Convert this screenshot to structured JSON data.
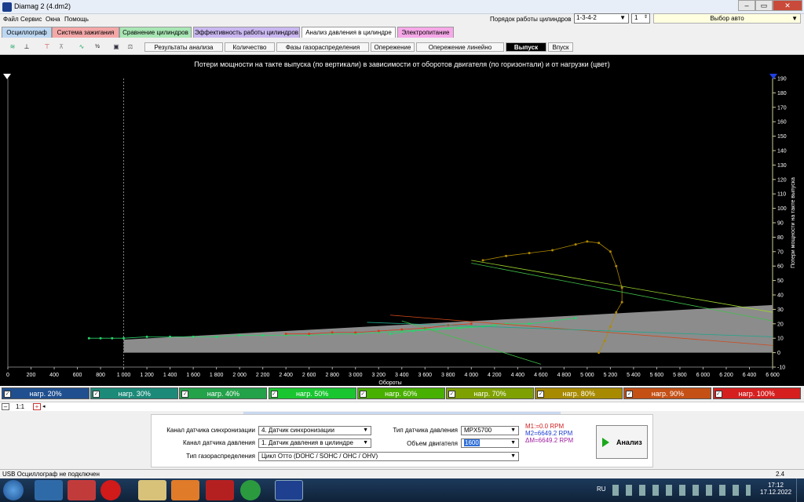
{
  "window": {
    "title": "Diamag 2 (4.dm2)"
  },
  "menu": [
    "Файл",
    "Сервис",
    "Окна",
    "Помощь"
  ],
  "cylinders": {
    "label": "Порядок работы цилиндров",
    "order": "1-3-4-2",
    "spin": "1",
    "auto": "Выбор авто"
  },
  "tabs": [
    {
      "label": "Осциллограф",
      "color": "#bcd7f2"
    },
    {
      "label": "Система зажигания",
      "color": "#f4a7a7"
    },
    {
      "label": "Сравнение цилиндров",
      "color": "#a8e6b4"
    },
    {
      "label": "Эффективность работы цилиндров",
      "color": "#c9b7f0"
    },
    {
      "label": "Анализ давления в цилиндре",
      "color": "#ffffff"
    },
    {
      "label": "Электропитание",
      "color": "#f6a8e8"
    }
  ],
  "subtabs": [
    "Результаты анализа",
    "Количество",
    "Фазы газораспределения",
    "Опережение",
    "Опережение линейно",
    "Выпуск",
    "Впуск"
  ],
  "chart_title": "Потери мощности на такте выпуска (по вертикали) в зависимости от оборотов двигателя (по горизонтали) и от нагрузки (цвет)",
  "chart_data": {
    "type": "scatter",
    "title": "Потери мощности на такте выпуска (по вертикали) в зависимости от оборотов двигателя (по горизонтали) и от нагрузки (цвет)",
    "xlabel": "Обороты",
    "ylabel": "Потери мощности на такте выпуска",
    "xlim": [
      0,
      6600
    ],
    "ylim": [
      -10,
      190
    ],
    "xticks": [
      0,
      200,
      400,
      600,
      800,
      1000,
      1200,
      1400,
      1600,
      1800,
      2000,
      2200,
      2400,
      2600,
      2800,
      3000,
      3200,
      3400,
      3600,
      3800,
      4000,
      4200,
      4400,
      4600,
      4800,
      5000,
      5200,
      5400,
      5600,
      5800,
      6000,
      6200,
      6400,
      6600
    ],
    "xtick_labels": [
      "0",
      "200",
      "400",
      "600",
      "800",
      "1 000",
      "1 200",
      "1 400",
      "1 600",
      "1 800",
      "2 000",
      "2 200",
      "2 400",
      "2 600",
      "2 800",
      "3 000",
      "3 200",
      "3 400",
      "3 600",
      "3 800",
      "4 000",
      "4 200",
      "4 400",
      "4 600",
      "4 800",
      "5 000",
      "5 200",
      "5 400",
      "5 600",
      "5 800",
      "6 000",
      "6 200",
      "6 400",
      "6 600"
    ],
    "yticks": [
      -10,
      0,
      10,
      20,
      30,
      40,
      50,
      60,
      70,
      80,
      90,
      100,
      110,
      120,
      130,
      140,
      150,
      160,
      170,
      180,
      190
    ],
    "series": [
      {
        "name": "нагр. 30%",
        "color": "#2bd26a",
        "points": [
          [
            700,
            10
          ],
          [
            800,
            10
          ],
          [
            900,
            10
          ],
          [
            1000,
            10
          ],
          [
            1200,
            11
          ],
          [
            1400,
            11
          ],
          [
            1600,
            11
          ],
          [
            1800,
            11
          ],
          [
            2000,
            12
          ],
          [
            2200,
            12
          ],
          [
            2400,
            12
          ],
          [
            2600,
            12
          ],
          [
            2800,
            13
          ],
          [
            3000,
            13
          ],
          [
            3200,
            14
          ],
          [
            3400,
            15
          ],
          [
            3600,
            16
          ],
          [
            3800,
            17
          ],
          [
            4000,
            18
          ],
          [
            4200,
            19
          ]
        ]
      },
      {
        "name": "нагр. 60%",
        "color": "#2bd26a",
        "points": [
          [
            3300,
            13
          ],
          [
            3500,
            15
          ],
          [
            3700,
            16
          ],
          [
            3900,
            17
          ],
          [
            4100,
            18
          ],
          [
            4300,
            20
          ],
          [
            4500,
            20
          ],
          [
            4700,
            22
          ],
          [
            4900,
            24
          ]
        ]
      },
      {
        "name": "нагр. 80%",
        "color": "#b08a00",
        "points": [
          [
            4100,
            64
          ],
          [
            4300,
            67
          ],
          [
            4500,
            69
          ],
          [
            4700,
            71
          ],
          [
            4900,
            75
          ],
          [
            5000,
            77
          ],
          [
            5100,
            76
          ],
          [
            5200,
            70
          ],
          [
            5250,
            60
          ],
          [
            5300,
            45
          ],
          [
            5300,
            35
          ],
          [
            5250,
            28
          ],
          [
            5200,
            18
          ],
          [
            5150,
            8
          ],
          [
            5100,
            0
          ]
        ]
      },
      {
        "name": "нагр. 90%",
        "color": "#d03a1a",
        "points": [
          [
            2400,
            13
          ],
          [
            2600,
            13
          ],
          [
            2800,
            14
          ],
          [
            3000,
            14
          ],
          [
            3200,
            15
          ],
          [
            3400,
            16
          ],
          [
            3600,
            17
          ],
          [
            3800,
            19
          ],
          [
            4000,
            20
          ]
        ]
      }
    ],
    "loss_band": {
      "x": [
        1000,
        6600
      ],
      "y_low": [
        0,
        0
      ],
      "y_high": [
        9,
        33
      ]
    }
  },
  "legend": [
    {
      "label": "нагр. 20%",
      "color": "#1f4f8f"
    },
    {
      "label": "нагр. 30%",
      "color": "#1b8a78"
    },
    {
      "label": "нагр. 40%",
      "color": "#23a24a"
    },
    {
      "label": "нагр. 50%",
      "color": "#19c630"
    },
    {
      "label": "нагр. 60%",
      "color": "#48b000"
    },
    {
      "label": "нагр. 70%",
      "color": "#7ea000"
    },
    {
      "label": "нагр. 80%",
      "color": "#a88a00"
    },
    {
      "label": "нагр. 90%",
      "color": "#c45016"
    },
    {
      "label": "нагр. 100%",
      "color": "#d62020"
    }
  ],
  "zoom": "1:1",
  "panel": {
    "sync_label": "Канал датчика синхронизации",
    "sync_value": "4.  Датчик синхронизации",
    "pressure_label": "Канал датчика давления",
    "pressure_value": "1.  Датчик давления в цилиндре",
    "timing_label": "Тип газораспределения",
    "timing_value": "Цикл Отто (DOHC / SOHC / OHC / OHV)",
    "sensor_label": "Тип датчика давления",
    "sensor_value": "MPX5700",
    "volume_label": "Объем двигателя",
    "volume_value": "1600",
    "m1": "M1:=0.0 RPM",
    "m2": "M2=6649.2 RPM",
    "dm": "ΔM=6649.2 RPM",
    "analyze": "Анализ"
  },
  "status": {
    "left": "USB Осциллограф не подключен",
    "right": "2.4"
  },
  "taskbar": {
    "lang": "RU",
    "time": "17:12",
    "date": "17.12.2022"
  }
}
